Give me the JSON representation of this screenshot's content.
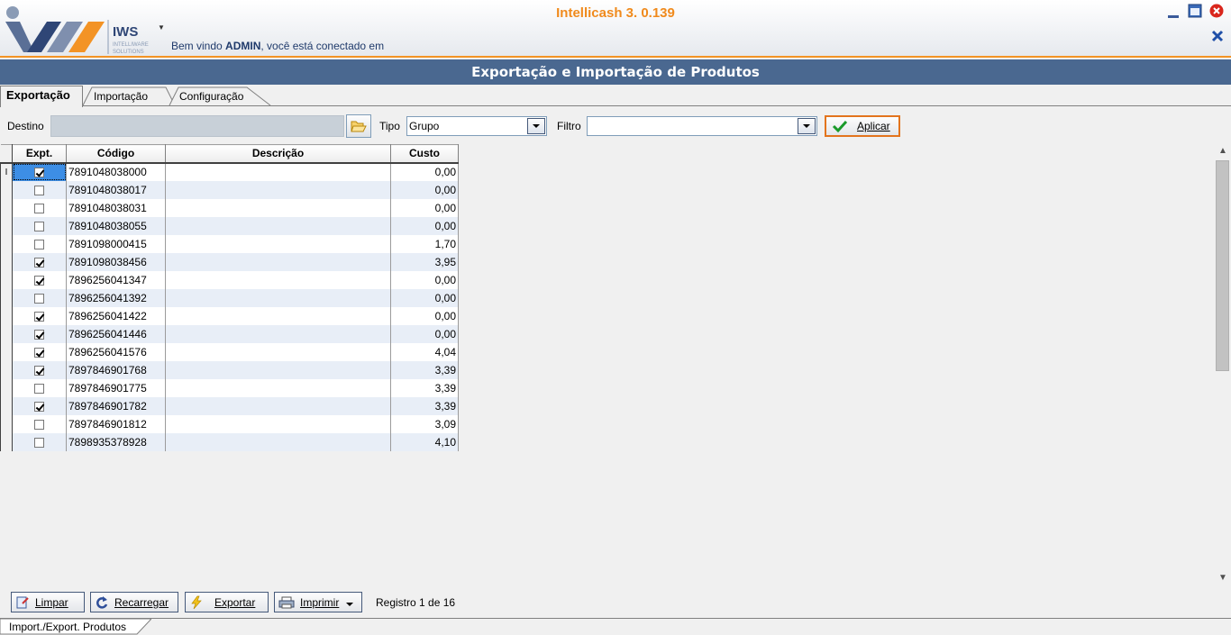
{
  "app": {
    "title": "Intellicash 3. 0.139",
    "logo_text": "IWS",
    "logo_sub1": "INTELLIWARE",
    "logo_sub2": "SOLUTIONS",
    "welcome_prefix": "Bem vindo ",
    "welcome_user": "ADMIN",
    "welcome_suffix": ", você está conectado em"
  },
  "page_title": "Exportação e Importação de Produtos",
  "tabs": [
    {
      "label": "Exportação",
      "active": true
    },
    {
      "label": "Importação",
      "active": false
    },
    {
      "label": "Configuração",
      "active": false
    }
  ],
  "toolbar": {
    "destino_label": "Destino",
    "destino_value": "",
    "tipo_label": "Tipo",
    "tipo_value": "Grupo",
    "filtro_label": "Filtro",
    "filtro_value": "",
    "aplicar_label": "Aplicar"
  },
  "grid": {
    "columns": [
      "Expt.",
      "Código",
      "Descrição",
      "Custo"
    ],
    "rows": [
      {
        "expt": true,
        "codigo": "7891048038000",
        "descricao": "",
        "custo": "0,00"
      },
      {
        "expt": false,
        "codigo": "7891048038017",
        "descricao": "",
        "custo": "0,00"
      },
      {
        "expt": false,
        "codigo": "7891048038031",
        "descricao": "",
        "custo": "0,00"
      },
      {
        "expt": false,
        "codigo": "7891048038055",
        "descricao": "",
        "custo": "0,00"
      },
      {
        "expt": false,
        "codigo": "7891098000415",
        "descricao": "",
        "custo": "1,70"
      },
      {
        "expt": true,
        "codigo": "7891098038456",
        "descricao": "",
        "custo": "3,95"
      },
      {
        "expt": true,
        "codigo": "7896256041347",
        "descricao": "",
        "custo": "0,00"
      },
      {
        "expt": false,
        "codigo": "7896256041392",
        "descricao": "",
        "custo": "0,00"
      },
      {
        "expt": true,
        "codigo": "7896256041422",
        "descricao": "",
        "custo": "0,00"
      },
      {
        "expt": true,
        "codigo": "7896256041446",
        "descricao": "",
        "custo": "0,00"
      },
      {
        "expt": true,
        "codigo": "7896256041576",
        "descricao": "",
        "custo": "4,04"
      },
      {
        "expt": true,
        "codigo": "7897846901768",
        "descricao": "",
        "custo": "3,39"
      },
      {
        "expt": false,
        "codigo": "7897846901775",
        "descricao": "",
        "custo": "3,39"
      },
      {
        "expt": true,
        "codigo": "7897846901782",
        "descricao": "",
        "custo": "3,39"
      },
      {
        "expt": false,
        "codigo": "7897846901812",
        "descricao": "",
        "custo": "3,09"
      },
      {
        "expt": false,
        "codigo": "7898935378928",
        "descricao": "",
        "custo": "4,10"
      }
    ]
  },
  "bottom": {
    "limpar_label": "Limpar",
    "recarregar_label": "Recarregar",
    "exportar_label": "Exportar",
    "imprimir_label": "Imprimir",
    "registro": "Registro 1 de 16"
  },
  "status_tab": "Import./Export. Produtos",
  "colors": {
    "accent_orange": "#f08a1c",
    "title_bar": "#4a6890",
    "row_alt": "#e8eef7"
  }
}
